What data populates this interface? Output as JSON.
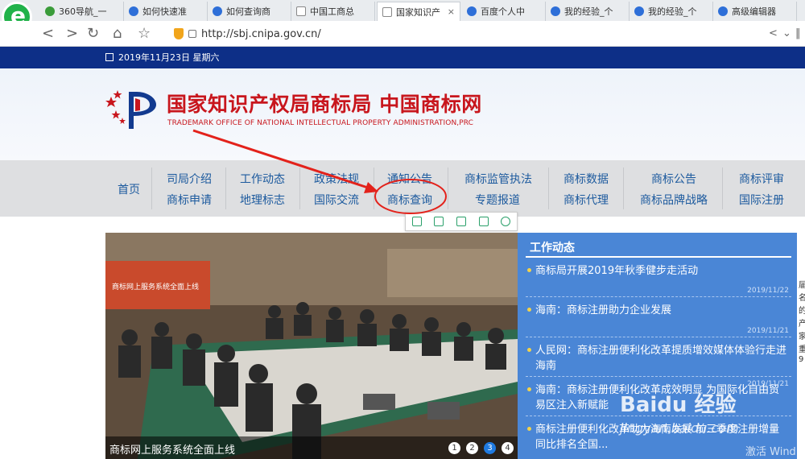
{
  "browser": {
    "tabs": [
      {
        "label": "360导航_一",
        "icon": "360-icon",
        "active": false
      },
      {
        "label": "如何快速准",
        "icon": "baidu-paw-icon",
        "active": false
      },
      {
        "label": "如何查询商",
        "icon": "baidu-paw-icon",
        "active": false
      },
      {
        "label": "中国工商总",
        "icon": "document-icon",
        "active": false
      },
      {
        "label": "国家知识产",
        "icon": "document-icon",
        "active": true
      },
      {
        "label": "百度个人中",
        "icon": "baidu-paw-icon",
        "active": false
      },
      {
        "label": "我的经验_个",
        "icon": "baidu-paw-icon",
        "active": false
      },
      {
        "label": "我的经验_个",
        "icon": "baidu-paw-icon",
        "active": false
      },
      {
        "label": "高级编辑器",
        "icon": "baidu-paw-icon",
        "active": false
      }
    ],
    "tab_close_glyph": "×",
    "url": "http://sbj.cnipa.gov.cn/",
    "back_glyph": "<",
    "forward_glyph": ">",
    "reload_glyph": "↻",
    "home_glyph": "⌂",
    "star_glyph": "☆",
    "share_glyph": "<",
    "menu_glyph": "⌄",
    "extra_glyph": "‖"
  },
  "site": {
    "date": "2019年11月23日 星期六",
    "title_cn": "国家知识产权局商标局 中国商标网",
    "title_en": "TRADEMARK OFFICE OF NATIONAL INTELLECTUAL PROPERTY ADMINISTRATION,PRC",
    "nav": {
      "home": "首页",
      "col1": [
        "司局介绍",
        "商标申请"
      ],
      "col2": [
        "工作动态",
        "地理标志"
      ],
      "col3": [
        "政策法规",
        "国际交流"
      ],
      "col4": [
        "通知公告",
        "商标查询"
      ],
      "col5": [
        "商标监管执法",
        "专题报道"
      ],
      "col6": [
        "商标数据",
        "商标代理"
      ],
      "col7": [
        "商标公告",
        "商标品牌战略"
      ],
      "col8": [
        "商标评审",
        "国际注册"
      ]
    },
    "slideshow": {
      "caption": "商标网上服务系统全面上线",
      "banner_text": "商标网上服务系统全面上线",
      "pages": [
        "1",
        "2",
        "3",
        "4"
      ],
      "active_page": "3"
    },
    "news": {
      "heading": "工作动态",
      "items": [
        {
          "text": "商标局开展2019年秋季健步走活动",
          "date": "2019/11/22"
        },
        {
          "text": "海南：商标注册助力企业发展",
          "date": "2019/11/21"
        },
        {
          "text": "人民网：商标注册便利化改革提质增效媒体体验行走进海南",
          "date": "2019/11/21"
        },
        {
          "text": "海南：商标注册便利化改革成效明显 为国际化自由贸易区注入新赋能",
          "date": ""
        },
        {
          "text": "商标注册便利化改革助力海南发展 前三季度注册增量同比排名全国...",
          "date": ""
        }
      ]
    },
    "right_sliver": [
      "届",
      "名",
      "的",
      "产",
      "家",
      "重",
      "9"
    ]
  },
  "overlay": {
    "watermark": "Baidu 经验",
    "watermark_sub": "jingyan.baidu.com",
    "activate": "激活 Wind"
  },
  "colors": {
    "brand_red": "#c8161d",
    "nav_blue": "#1c5a9e",
    "top_strip": "#0d2f87",
    "news_panel": "#4a86d6",
    "annotation_red": "#e3221b"
  }
}
